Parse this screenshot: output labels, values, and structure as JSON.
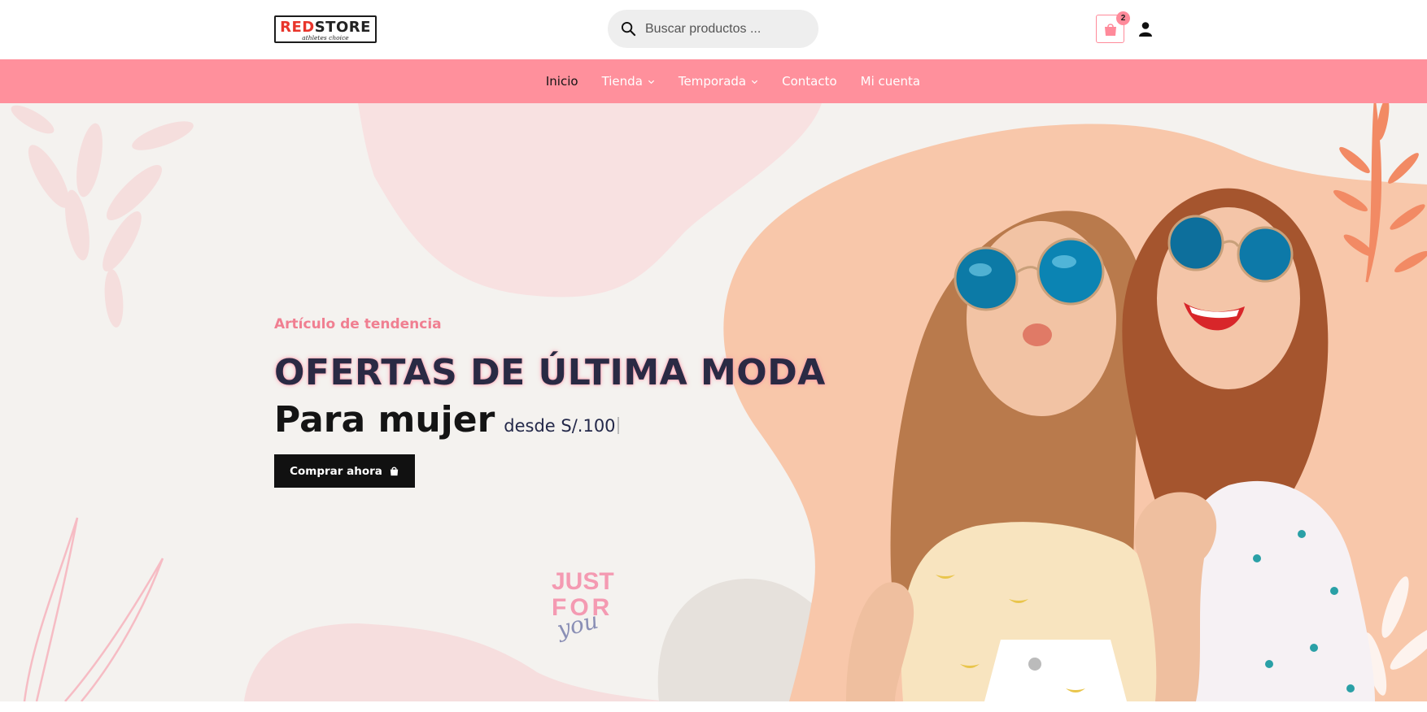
{
  "header": {
    "logo": {
      "brand_red": "RED",
      "brand_dark": "STORE",
      "tagline": "athletes choice"
    },
    "search": {
      "placeholder": "Buscar productos ..."
    },
    "cart": {
      "count": "2"
    }
  },
  "nav": {
    "items": [
      {
        "label": "Inicio",
        "active": true,
        "dropdown": false
      },
      {
        "label": "Tienda",
        "active": false,
        "dropdown": true
      },
      {
        "label": "Temporada",
        "active": false,
        "dropdown": true
      },
      {
        "label": "Contacto",
        "active": false,
        "dropdown": false
      },
      {
        "label": "Mi cuenta",
        "active": false,
        "dropdown": false
      }
    ]
  },
  "hero": {
    "eyebrow": "Artículo de tendencia",
    "headline": "OFERTAS DE ÚLTIMA MODA",
    "subline_main": "Para mujer",
    "subline_price": "desde S/.100",
    "cta_label": "Comprar ahora",
    "badge": {
      "line1": "JUST",
      "line2": "FOR",
      "line3": "you"
    }
  },
  "colors": {
    "nav_bg": "#ff909c",
    "accent_pink": "#f07f91",
    "hero_bg": "#f4f2ef",
    "peach_blob": "#f8c7aa",
    "cta_bg": "#111111",
    "logo_red": "#e8352b"
  },
  "icons": [
    "search-icon",
    "shopping-bag-icon",
    "user-icon",
    "chevron-down-icon",
    "bag-icon"
  ]
}
